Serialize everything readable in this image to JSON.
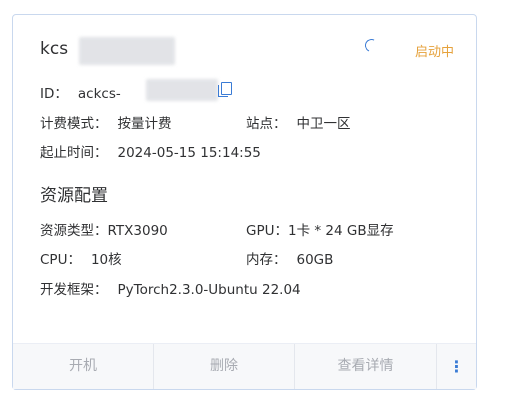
{
  "card": {
    "name": "kcs",
    "status": "启动中",
    "id_label": "ID：",
    "id_value": "ackcs-",
    "billing_label": "计费模式：",
    "billing_value": "按量计费",
    "site_label": "站点：",
    "site_value": "中卫一区",
    "time_label": "起止时间：",
    "time_value": "2024-05-15 15:14:55",
    "section_title": "资源配置",
    "resource_type_label": "资源类型：",
    "resource_type_value": "RTX3090",
    "gpu_label": "GPU：",
    "gpu_value": "1卡 * 24 GB显存",
    "cpu_label": "CPU：",
    "cpu_value": "10核",
    "memory_label": "内存：",
    "memory_value": "60GB",
    "framework_label": "开发框架：",
    "framework_value": "PyTorch2.3.0-Ubuntu 22.04"
  },
  "actions": {
    "power_on": "开机",
    "delete": "删除",
    "details": "查看详情",
    "more": "⋮"
  },
  "colors": {
    "status": "#e6a23c",
    "accent": "#3a7bd5",
    "disabled_text": "#a8abb2"
  },
  "icons": [
    "loading-spinner-icon",
    "copy-icon",
    "more-vertical-icon"
  ]
}
